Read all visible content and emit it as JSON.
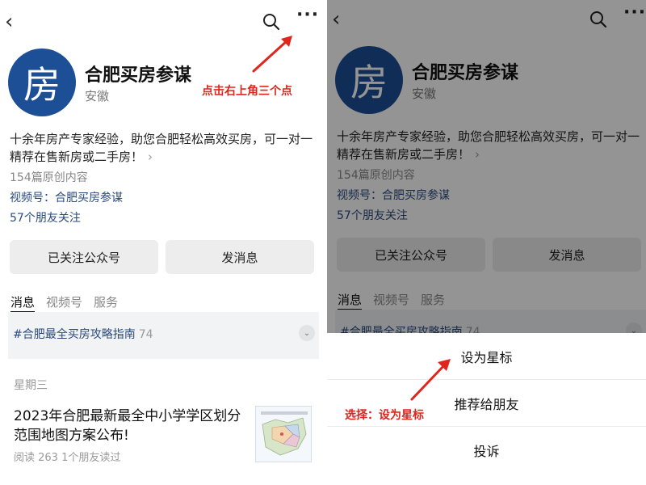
{
  "account": {
    "name": "合肥买房参谋",
    "avatar_char": "房",
    "region": "安徽",
    "intro": "十余年房产专家经验，助您合肥轻松高效买房，可一对一精荐在售新房或二手房！",
    "intro_more": "›",
    "articles_count": "154篇原创内容",
    "channel": "视频号：合肥买房参谋",
    "friends_following": "57个朋友关注"
  },
  "nav": {
    "back_glyph": "‹",
    "more_glyph": "···"
  },
  "actions": {
    "followed_label": "已关注公众号",
    "message_label": "发消息"
  },
  "tabs": [
    {
      "label": "消息"
    },
    {
      "label": "视频号"
    },
    {
      "label": "服务"
    }
  ],
  "topic": {
    "text": "#合肥最全买房攻略指南",
    "count": "74",
    "expand_glyph": "⌄"
  },
  "feed": {
    "day": "星期三",
    "article_title": "2023年合肥最新最全中小学学区划分范围地图方案公布!",
    "article_meta": "阅读 263   1个朋友读过"
  },
  "annotations": {
    "left_hint": "点击右上角三个点",
    "right_hint": "选择：设为星标"
  },
  "sheet": [
    {
      "label": "设为星标"
    },
    {
      "label": "推荐给朋友"
    },
    {
      "label": "投诉"
    }
  ],
  "colors": {
    "accent_red": "#e0251d",
    "avatar_blue": "#1d4f97",
    "link_blue": "#2a4a7d"
  }
}
